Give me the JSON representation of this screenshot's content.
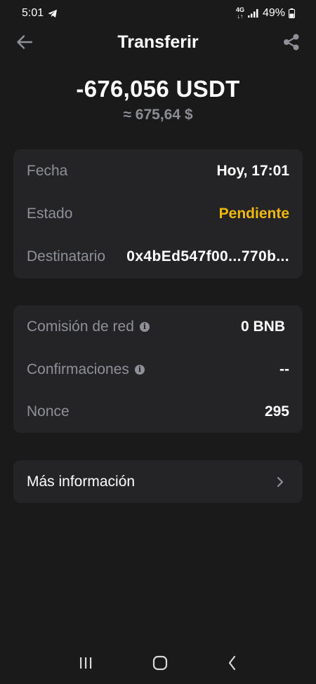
{
  "status_bar": {
    "time": "5:01",
    "network": "4G",
    "battery": "49%"
  },
  "header": {
    "title": "Transferir"
  },
  "amount": {
    "value": "-676,056 USDT",
    "fiat": "≈ 675,64 $"
  },
  "details": {
    "date_label": "Fecha",
    "date_value": "Hoy, 17:01",
    "status_label": "Estado",
    "status_value": "Pendiente",
    "recipient_label": "Destinatario",
    "recipient_value": "0x4bEd547f00...770b..."
  },
  "network_info": {
    "fee_label": "Comisión de red",
    "fee_value": "0 BNB",
    "confirmations_label": "Confirmaciones",
    "confirmations_value": "--",
    "nonce_label": "Nonce",
    "nonce_value": "295"
  },
  "more": {
    "label": "Más información"
  },
  "colors": {
    "background": "#1a1a1b",
    "card": "#242426",
    "pending": "#f0b90b",
    "muted": "#8f9198"
  }
}
